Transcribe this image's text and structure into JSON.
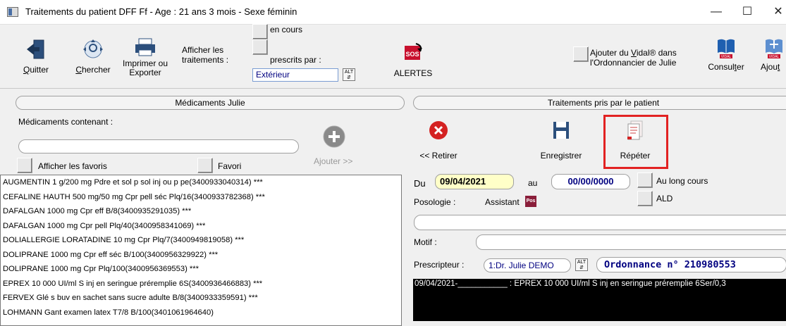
{
  "window": {
    "title": "Traitements du patient DFF Ff - Age : 21 ans 3 mois - Sexe féminin",
    "minimize": "—",
    "maximize": "☐",
    "close": "✕"
  },
  "toolbar": {
    "quit_prefix": "Q",
    "quit_rest": "uitter",
    "search_prefix": "C",
    "search_rest": "hercher",
    "print_line1": "Imprimer ou",
    "print_line2": "Exporter",
    "show_treatments": "Afficher les\ntraitements :",
    "in_progress": "en cours",
    "prescribed_by": "prescrits par :",
    "prescriber_select": "Extérieur",
    "alt_label": "ALT",
    "alerts_label": "ALERTES",
    "sos_label": "SOS",
    "add_vidal_pre": "Ajouter du ",
    "add_vidal_ul": "V",
    "add_vidal_post": "idal® dans",
    "add_vidal_line2": "l'Ordonnancier de Julie",
    "consult_pre": "Consul",
    "consult_ul": "t",
    "consult_post": "er",
    "add_label_pre": "Ajou",
    "add_label_ul": "t",
    "vidal_badge": "VIDAL"
  },
  "left_panel": {
    "header": "Médicaments Julie",
    "search_label": "Médicaments contenant :",
    "search_value": "",
    "favorites_toggle": "Afficher les favoris",
    "favorite": "Favori",
    "add_button": "Ajouter >>",
    "add_ul": "A",
    "drugs": [
      "AUGMENTIN 1 g/200 mg Pdre et sol p sol inj ou p pe(3400933040314) ***",
      "CEFALINE HAUTH 500 mg/50 mg Cpr pell séc Plq/16(3400933782368) ***",
      "DAFALGAN 1000 mg Cpr eff B/8(3400935291035) ***",
      "DAFALGAN 1000 mg Cpr pell Plq/40(3400958341069) ***",
      "DOLIALLERGIE LORATADINE 10 mg Cpr Plq/7(3400949819058) ***",
      "DOLIPRANE 1000 mg Cpr eff séc B/100(3400956329922) ***",
      "DOLIPRANE 1000 mg Cpr Plq/100(3400956369553) ***",
      "EPREX 10 000 UI/ml S inj en seringue préremplie 6S(3400936466883) ***",
      "FERVEX Glé s buv en sachet sans sucre adulte B/8(3400933359591) ***",
      "LOHMANN Gant examen latex T7/8 B/100(3401061964640)"
    ]
  },
  "right_panel": {
    "header": "Traitements pris par le patient",
    "remove_button": "<< Retirer",
    "remove_ul": "R",
    "save_button": "Enregistrer",
    "repeat_button": "Répéter",
    "from_label": "Du",
    "from_date": "09/04/2021",
    "to_label": "au",
    "to_date": "00/00/0000",
    "long_term": "Au long cours",
    "ald": "ALD",
    "dosage_label": "Posologie :",
    "assistant_label": "Assistant",
    "pos_badge": "Pos",
    "dosage_value": "",
    "reason_label": "Motif :",
    "reason_value": "",
    "prescriber_label": "Prescripteur :",
    "prescriber_value": "1:Dr. Julie DEMO",
    "alt_label": "ALT",
    "ordonnance": "Ordonnance n° 210980553",
    "treatment_line": "09/04/2021-___________ : EPREX 10 000 UI/ml S inj en seringue préremplie 6Ser/0,3"
  },
  "colors": {
    "date_from_bg": "#ffffc8",
    "highlight_border": "#e22222",
    "ordonnance_text": "#000080"
  }
}
